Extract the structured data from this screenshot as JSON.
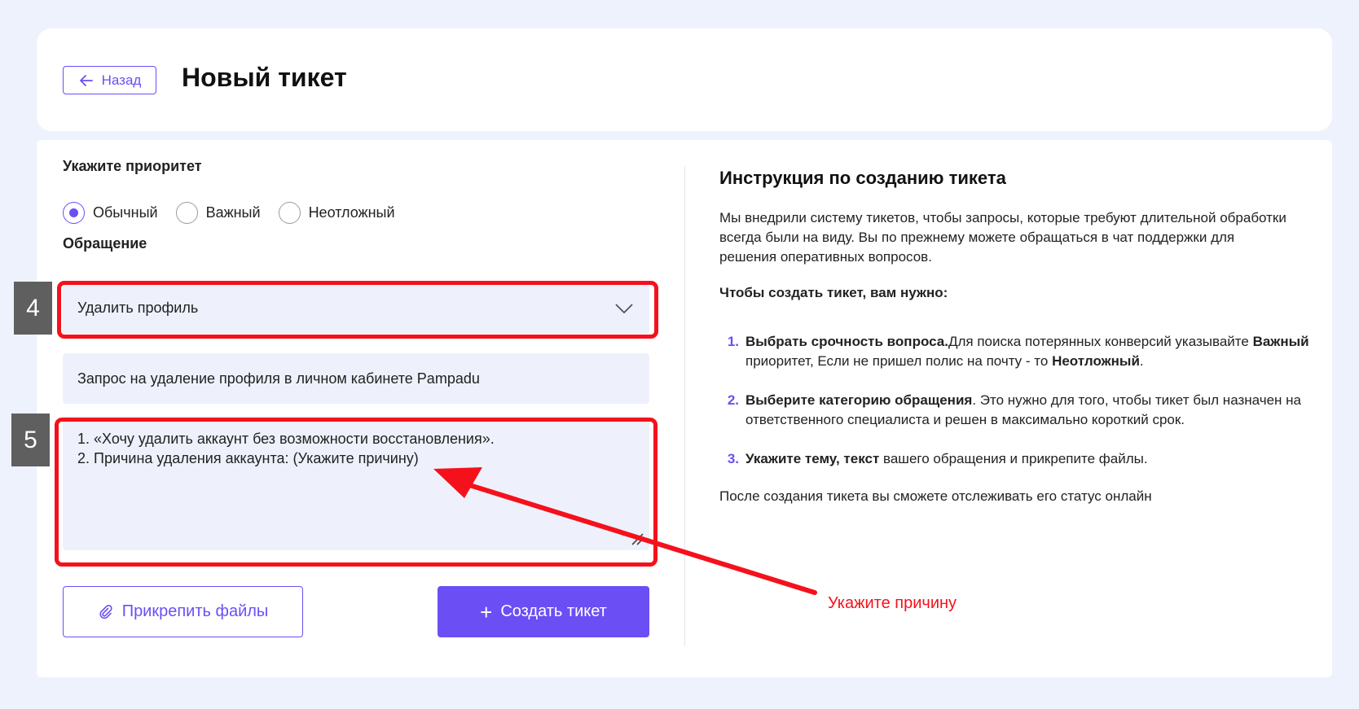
{
  "header": {
    "back_label": "Назад",
    "title": "Новый тикет"
  },
  "form": {
    "priority_label": "Укажите приоритет",
    "priority_options": [
      {
        "label": "Обычный",
        "checked": true
      },
      {
        "label": "Важный",
        "checked": false
      },
      {
        "label": "Неотложный",
        "checked": false
      }
    ],
    "request_label": "Обращение",
    "category_value": "Удалить профиль",
    "subject_value": "Запрос на удаление профиля в личном кабинете Pampadu",
    "message_lines": [
      "1. «Хочу удалить аккаунт без возможности восстановления».",
      "2. Причина удаления аккаунта: (Укажите причину)"
    ],
    "attach_label": "Прикрепить файлы",
    "create_label": "Создать тикет"
  },
  "instructions": {
    "title": "Инструкция по созданию тикета",
    "intro": "Мы внедрили систему тикетов, чтобы запросы, которые требуют длительной обработки всегда были на виду. Вы по прежнему можете обращаться в чат поддержки для решения оперативных вопросов.",
    "steps_heading": "Чтобы создать тикет, вам нужно:",
    "steps": [
      {
        "num": "1.",
        "bold": "Выбрать срочность вопроса.",
        "text_a": "Для поиска потерянных конверсий указывайте ",
        "bold_b": "Важный",
        "text_b": " приоритет, Если не пришел полис на почту - то ",
        "bold_c": "Неотложный",
        "text_c": "."
      },
      {
        "num": "2.",
        "bold": "Выберите категорию обращения",
        "text_a": ". Это нужно для того, чтобы тикет был назначен на ответственного специалиста и решен в максимально короткий срок."
      },
      {
        "num": "3.",
        "bold": "Укажите тему, текст",
        "text_a": " вашего обращения и прикрепите файлы."
      }
    ],
    "footer": "После создания тикета вы сможете отслеживать его статус онлайн"
  },
  "annotations": {
    "badge_4": "4",
    "badge_5": "5",
    "note": "Укажите причину",
    "color": "#f5111c"
  },
  "colors": {
    "accent": "#6c4ef5",
    "background": "#eef2fc",
    "field_bg": "#eef1fc"
  }
}
